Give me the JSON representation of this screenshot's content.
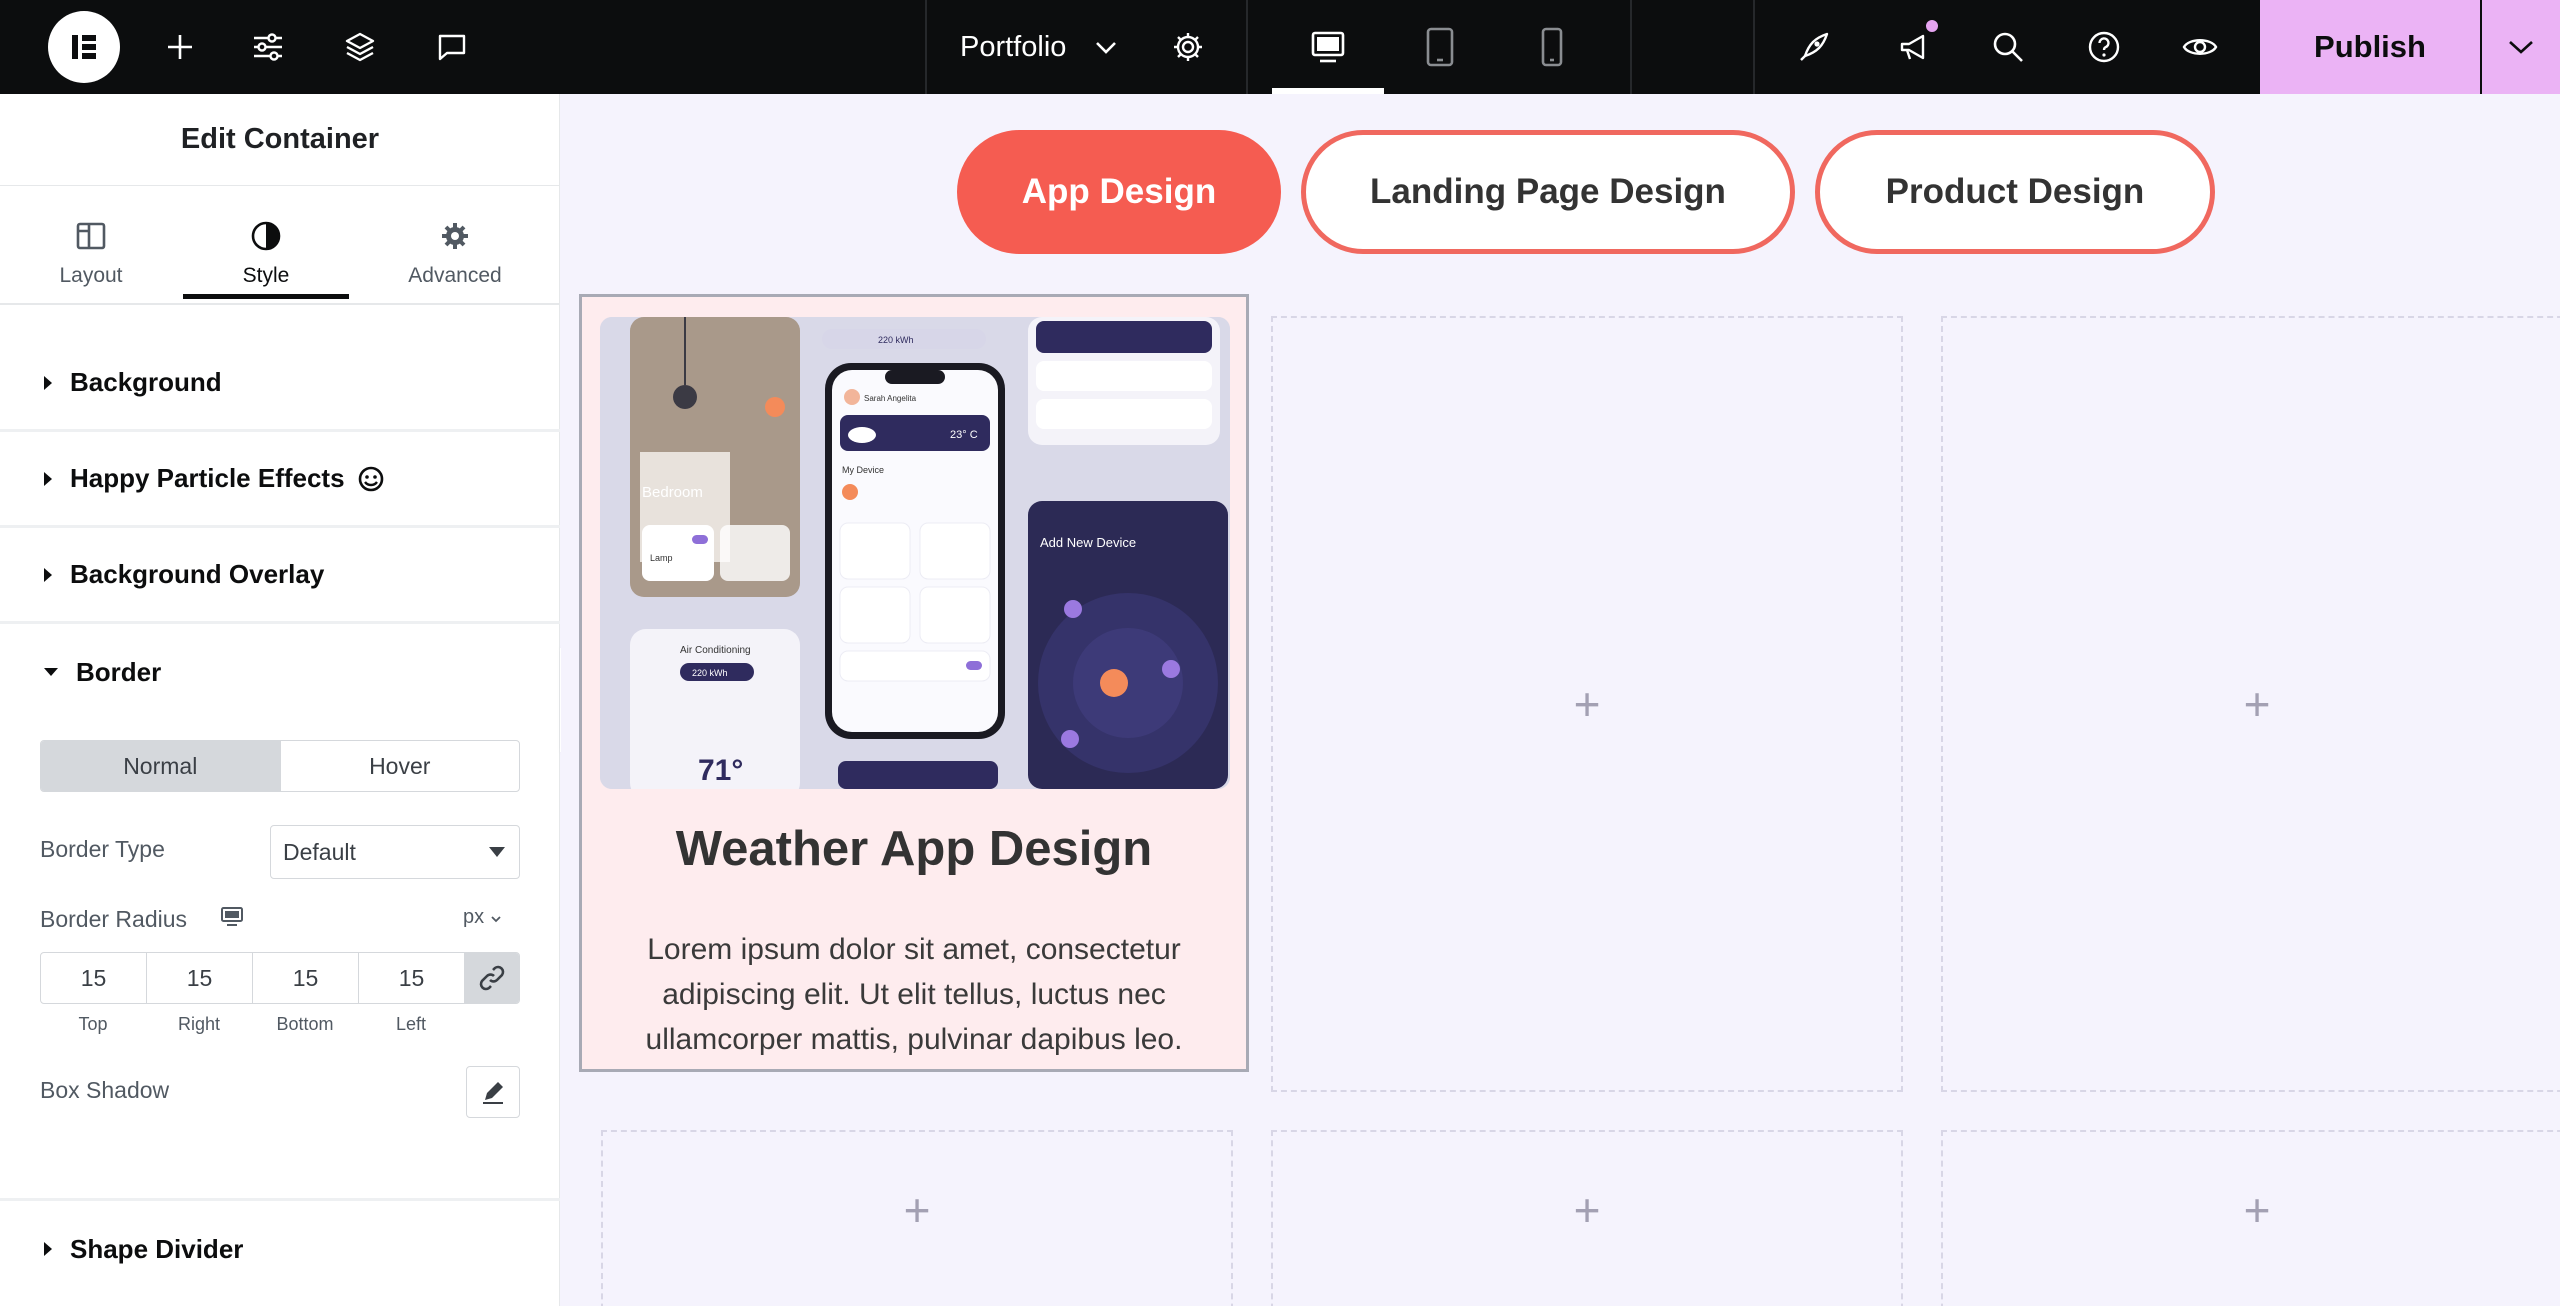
{
  "topbar": {
    "site_name": "Portfolio",
    "publish_label": "Publish",
    "icons": [
      "elementor-logo-icon",
      "add-icon",
      "settings-sliders-icon",
      "layers-icon",
      "comments-icon",
      "chevron-down-icon",
      "gear-icon",
      "desktop-icon",
      "tablet-icon",
      "mobile-icon",
      "rocket-icon",
      "megaphone-icon",
      "search-icon",
      "help-icon",
      "eye-icon"
    ]
  },
  "panel": {
    "title": "Edit Container",
    "tabs": [
      {
        "label": "Layout"
      },
      {
        "label": "Style"
      },
      {
        "label": "Advanced"
      }
    ],
    "sections": {
      "background": "Background",
      "particles": "Happy Particle Effects",
      "overlay": "Background Overlay",
      "border": "Border",
      "shape_divider": "Shape Divider"
    },
    "border": {
      "state_normal": "Normal",
      "state_hover": "Hover",
      "type_label": "Border Type",
      "type_value": "Default",
      "radius_label": "Border Radius",
      "unit": "px",
      "radius": {
        "top": "15",
        "right": "15",
        "bottom": "15",
        "left": "15"
      },
      "radius_labels": {
        "top": "Top",
        "right": "Right",
        "bottom": "Bottom",
        "left": "Left"
      },
      "box_shadow_label": "Box Shadow"
    }
  },
  "canvas": {
    "filters": [
      {
        "label": "App Design",
        "active": true
      },
      {
        "label": "Landing Page Design",
        "active": false
      },
      {
        "label": "Product Design",
        "active": false
      }
    ],
    "card": {
      "title": "Weather App Design",
      "text": "Lorem ipsum dolor sit amet, consectetur adipiscing elit. Ut elit tellus, luctus nec ullamcorper mattis, pulvinar dapibus leo."
    },
    "mock": {
      "bedroom": "Bedroom",
      "lamp": "Lamp",
      "air_conditioning": "Air Conditioning",
      "temp": "71°",
      "kwh": "220 kWh",
      "weather_temp": "23° C",
      "my_device": "My Device",
      "add_new_device": "Add New Device",
      "user": "Sarah Angelita"
    }
  },
  "colors": {
    "accent": "#f55c51",
    "publish": "#ebb3f5",
    "topbar": "#0c0d0e",
    "canvas": "#f5f3fd"
  }
}
